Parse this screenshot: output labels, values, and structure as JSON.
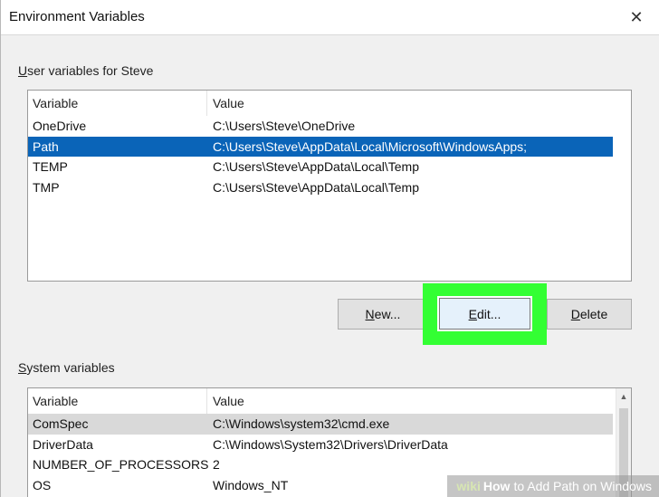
{
  "window": {
    "title": "Environment Variables",
    "close_glyph": "✕"
  },
  "user_section": {
    "label_mnemonic": "U",
    "label_rest": "ser variables for Steve",
    "columns": [
      "Variable",
      "Value"
    ],
    "rows": [
      {
        "variable": "OneDrive",
        "value": "C:\\Users\\Steve\\OneDrive",
        "selected": false
      },
      {
        "variable": "Path",
        "value": "C:\\Users\\Steve\\AppData\\Local\\Microsoft\\WindowsApps;",
        "selected": true
      },
      {
        "variable": "TEMP",
        "value": "C:\\Users\\Steve\\AppData\\Local\\Temp",
        "selected": false
      },
      {
        "variable": "TMP",
        "value": "C:\\Users\\Steve\\AppData\\Local\\Temp",
        "selected": false
      }
    ],
    "buttons": {
      "new_mnemonic": "N",
      "new_rest": "ew...",
      "edit_mnemonic": "E",
      "edit_rest": "dit...",
      "delete_mnemonic": "D",
      "delete_rest": "elete"
    }
  },
  "system_section": {
    "label_mnemonic": "S",
    "label_rest": "ystem variables",
    "columns": [
      "Variable",
      "Value"
    ],
    "rows": [
      {
        "variable": "ComSpec",
        "value": "C:\\Windows\\system32\\cmd.exe",
        "selected": true
      },
      {
        "variable": "DriverData",
        "value": "C:\\Windows\\System32\\Drivers\\DriverData",
        "selected": false
      },
      {
        "variable": "NUMBER_OF_PROCESSORS",
        "value": "2",
        "selected": false
      },
      {
        "variable": "OS",
        "value": "Windows_NT",
        "selected": false
      }
    ],
    "scroll_up_glyph": "▲"
  },
  "watermark": {
    "wiki": "wiki",
    "how": "How",
    "rest": "to Add Path on Windows"
  },
  "colors": {
    "selection_blue": "#0a64b8",
    "highlight_green": "#33ff33",
    "dialog_bg": "#f0f0f0"
  }
}
